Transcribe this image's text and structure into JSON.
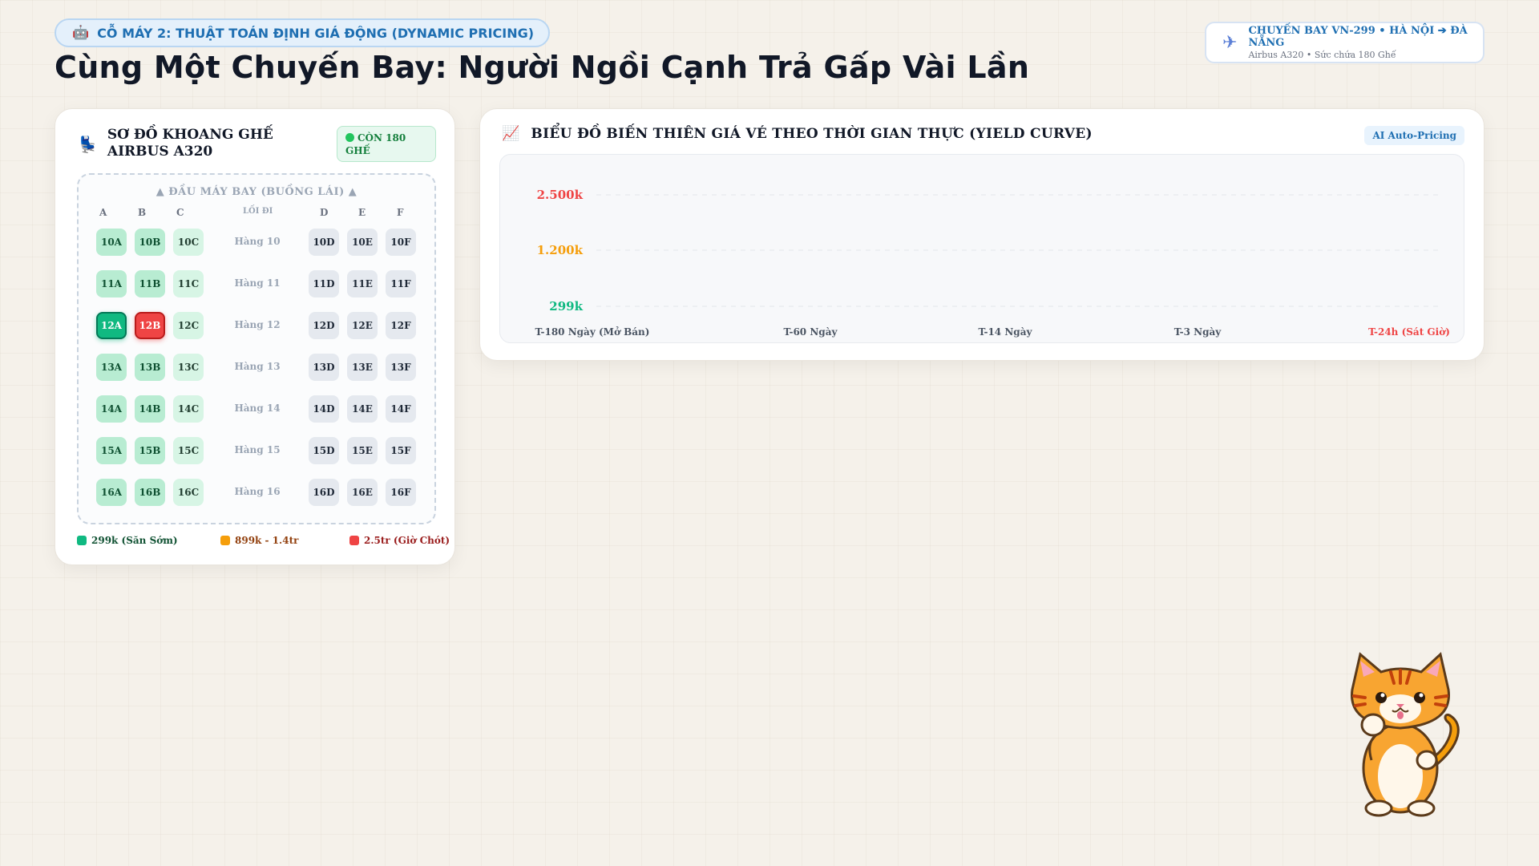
{
  "header": {
    "badge_icon": "robot-icon",
    "badge_text": "CỖ MÁY 2: THUẬT TOÁN ĐỊNH GIÁ ĐỘNG (DYNAMIC PRICING)",
    "title": "Cùng Một Chuyến Bay: Người Ngồi Cạnh Trả Gấp Vài Lần"
  },
  "flight": {
    "icon": "airplane-icon",
    "title": "CHUYẾN BAY VN-299 • HÀ NỘI ➔ ĐÀ NẴNG",
    "subtitle": "Airbus A320 • Sức chứa 180 Ghế"
  },
  "seatmap": {
    "icon": "seat-icon",
    "title": "SƠ ĐỒ KHOANG GHẾ AIRBUS A320",
    "remaining": "CÒN 180 GHẾ",
    "cockpit": "▲ ĐẦU MÁY BAY (BUỒNG LÁI) ▲",
    "aisle": "LỐI ĐI",
    "columns_left": [
      "A",
      "B",
      "C"
    ],
    "columns_right": [
      "D",
      "E",
      "F"
    ],
    "rows": [
      {
        "label": "Hàng 10",
        "seats": [
          "10A",
          "10B",
          "10C",
          "10D",
          "10E",
          "10F"
        ],
        "states": [
          "green",
          "green",
          "lightgreen",
          "grey",
          "grey",
          "grey"
        ]
      },
      {
        "label": "Hàng 11",
        "seats": [
          "11A",
          "11B",
          "11C",
          "11D",
          "11E",
          "11F"
        ],
        "states": [
          "green",
          "green",
          "lightgreen",
          "grey",
          "grey",
          "grey"
        ]
      },
      {
        "label": "Hàng 12",
        "seats": [
          "12A",
          "12B",
          "12C",
          "12D",
          "12E",
          "12F"
        ],
        "states": [
          "selected-green",
          "selected-red",
          "lightgreen",
          "grey",
          "grey",
          "grey"
        ]
      },
      {
        "label": "Hàng 13",
        "seats": [
          "13A",
          "13B",
          "13C",
          "13D",
          "13E",
          "13F"
        ],
        "states": [
          "green",
          "green",
          "lightgreen",
          "grey",
          "grey",
          "grey"
        ]
      },
      {
        "label": "Hàng 14",
        "seats": [
          "14A",
          "14B",
          "14C",
          "14D",
          "14E",
          "14F"
        ],
        "states": [
          "green",
          "green",
          "lightgreen",
          "grey",
          "grey",
          "grey"
        ]
      },
      {
        "label": "Hàng 15",
        "seats": [
          "15A",
          "15B",
          "15C",
          "15D",
          "15E",
          "15F"
        ],
        "states": [
          "green",
          "green",
          "lightgreen",
          "grey",
          "grey",
          "grey"
        ]
      },
      {
        "label": "Hàng 16",
        "seats": [
          "16A",
          "16B",
          "16C",
          "16D",
          "16E",
          "16F"
        ],
        "states": [
          "green",
          "green",
          "lightgreen",
          "grey",
          "grey",
          "grey"
        ]
      }
    ],
    "legend": [
      {
        "label": "299k (Săn Sớm)",
        "color": "#10b981",
        "text_color": "#0f5132"
      },
      {
        "label": "899k - 1.4tr",
        "color": "#f59e0b",
        "text_color": "#92400e"
      },
      {
        "label": "2.5tr (Giờ Chót)",
        "color": "#ef4444",
        "text_color": "#991b1b"
      }
    ]
  },
  "chart": {
    "icon": "chart-line-icon",
    "title": "BIỂU ĐỒ BIẾN THIÊN GIÁ VÉ THEO THỜI GIAN THỰC (YIELD CURVE)",
    "badge": "AI Auto-Pricing"
  },
  "chart_data": {
    "type": "line",
    "title": "BIỂU ĐỒ BIẾN THIÊN GIÁ VÉ THEO THỜI GIAN THỰC (YIELD CURVE)",
    "xlabel": "",
    "ylabel": "",
    "categories": [
      "T-180 Ngày (Mở Bán)",
      "T-60 Ngày",
      "T-14 Ngày",
      "T-3 Ngày",
      "T-24h (Sát Giờ)"
    ],
    "y_ticks": [
      {
        "label": "2.500k",
        "value": 2500,
        "color": "#ef4444"
      },
      {
        "label": "1.200k",
        "value": 1200,
        "color": "#f59e0b"
      },
      {
        "label": "299k",
        "value": 299,
        "color": "#10b981"
      }
    ],
    "category_colors": [
      "#4b5563",
      "#4b5563",
      "#4b5563",
      "#4b5563",
      "#ef4444"
    ],
    "series": [],
    "grid": true
  },
  "mascot": {
    "icon": "cat-mascot-icon"
  }
}
